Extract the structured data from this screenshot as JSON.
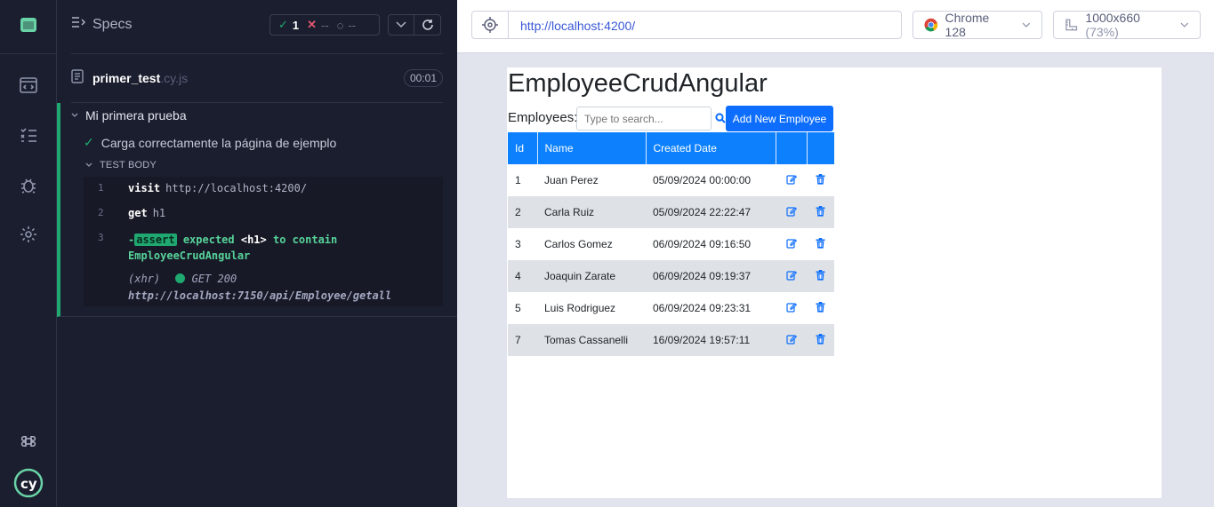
{
  "reporter": {
    "header_title": "Specs",
    "passed_count": "1",
    "failed_count": "--",
    "pending_count": "--",
    "spec_name": "primer_test",
    "spec_ext": ".cy.js",
    "duration": "00:01",
    "suite_title": "Mi primera prueba",
    "test_title": "Carga correctamente la página de ejemplo",
    "body_label": "TEST BODY",
    "commands": [
      {
        "num": "1",
        "name": "visit",
        "arg": "http://localhost:4200/"
      },
      {
        "num": "2",
        "name": "get",
        "arg": "h1"
      },
      {
        "num": "3",
        "name": "assert",
        "text_expected": "expected",
        "text_subject": "<h1>",
        "text_to_contain": "to contain",
        "text_value": "EmployeeCrudAngular"
      }
    ],
    "xhr": {
      "label": "(xhr)",
      "method_status": "GET 200",
      "url": "http://localhost:7150/api/Employee/getall"
    }
  },
  "browser": {
    "url": "http://localhost:4200/",
    "browser_name": "Chrome 128",
    "viewport": "1000x660",
    "zoom": "(73%)"
  },
  "app": {
    "title": "EmployeeCrudAngular",
    "employees_label": "Employees:",
    "search_placeholder": "Type to search...",
    "add_button": "Add New Employee",
    "columns": [
      "Id",
      "Name",
      "Created Date"
    ],
    "rows": [
      {
        "id": "1",
        "name": "Juan Perez",
        "date": "05/09/2024 00:00:00"
      },
      {
        "id": "2",
        "name": "Carla Ruiz",
        "date": "05/09/2024 22:22:47"
      },
      {
        "id": "3",
        "name": "Carlos Gomez",
        "date": "06/09/2024 09:16:50"
      },
      {
        "id": "4",
        "name": "Joaquin Zarate",
        "date": "06/09/2024 09:19:37"
      },
      {
        "id": "5",
        "name": "Luis Rodriguez",
        "date": "06/09/2024 09:23:31"
      },
      {
        "id": "7",
        "name": "Tomas Cassanelli",
        "date": "16/09/2024 19:57:11"
      }
    ]
  },
  "colors": {
    "pass": "#1fa971",
    "fail": "#e45770",
    "primary": "#0d6efd"
  }
}
